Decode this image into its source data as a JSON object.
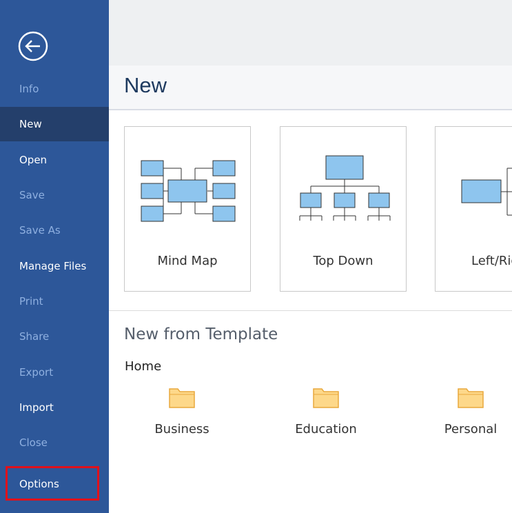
{
  "sidebar": {
    "items": [
      {
        "label": "Info"
      },
      {
        "label": "New"
      },
      {
        "label": "Open"
      },
      {
        "label": "Save"
      },
      {
        "label": "Save As"
      },
      {
        "label": "Manage Files"
      },
      {
        "label": "Print"
      },
      {
        "label": "Share"
      },
      {
        "label": "Export"
      },
      {
        "label": "Import"
      },
      {
        "label": "Close"
      },
      {
        "label": "Options"
      }
    ],
    "colors": {
      "background": "#2d5799",
      "active": "#243f6b",
      "disabled_text": "#8fb0e0",
      "highlight": "#e0111b"
    }
  },
  "main": {
    "title": "New",
    "diagrams": [
      {
        "label": "Mind Map",
        "icon": "mind-map-icon"
      },
      {
        "label": "Top Down",
        "icon": "org-chart-icon"
      },
      {
        "label": "Left/Rig",
        "icon": "left-right-icon"
      }
    ],
    "template_section": {
      "title": "New from Template",
      "category": "Home",
      "folders": [
        {
          "label": "Business",
          "icon": "folder-icon"
        },
        {
          "label": "Education",
          "icon": "folder-icon"
        },
        {
          "label": "Personal",
          "icon": "folder-icon"
        }
      ]
    }
  }
}
